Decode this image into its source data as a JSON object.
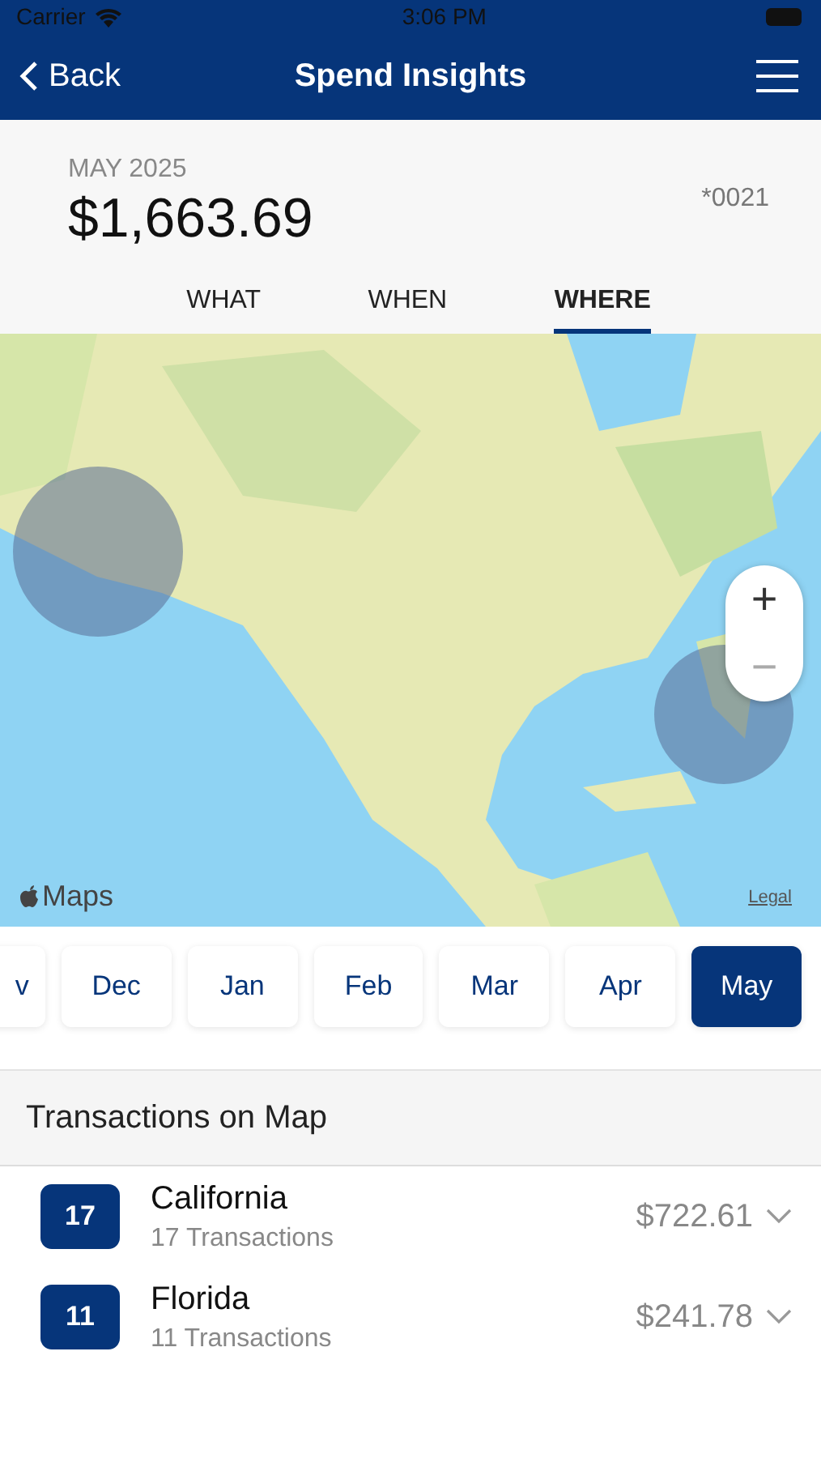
{
  "status_bar": {
    "carrier": "Carrier",
    "time": "3:06 PM"
  },
  "nav": {
    "back": "Back",
    "title": "Spend Insights"
  },
  "summary": {
    "period": "MAY 2025",
    "total": "$1,663.69",
    "account": "*0021"
  },
  "tabs": [
    {
      "label": "WHAT",
      "selected": false
    },
    {
      "label": "WHEN",
      "selected": false
    },
    {
      "label": "WHERE",
      "selected": true
    }
  ],
  "map": {
    "kind": "picture",
    "attribution": "Maps",
    "legal": "Legal",
    "zoom_in": "+",
    "zoom_out": "−"
  },
  "months": [
    {
      "label": "v",
      "selected": false
    },
    {
      "label": "Dec",
      "selected": false
    },
    {
      "label": "Jan",
      "selected": false
    },
    {
      "label": "Feb",
      "selected": false
    },
    {
      "label": "Mar",
      "selected": false
    },
    {
      "label": "Apr",
      "selected": false
    },
    {
      "label": "May",
      "selected": true
    }
  ],
  "section_title": "Transactions on Map",
  "locations": [
    {
      "count": "17",
      "name": "California",
      "subtitle": "17 Transactions",
      "amount": "$722.61",
      "expanded": false
    },
    {
      "count": "11",
      "name": "Florida",
      "subtitle": "11 Transactions",
      "amount": "$241.78",
      "expanded": false
    }
  ]
}
